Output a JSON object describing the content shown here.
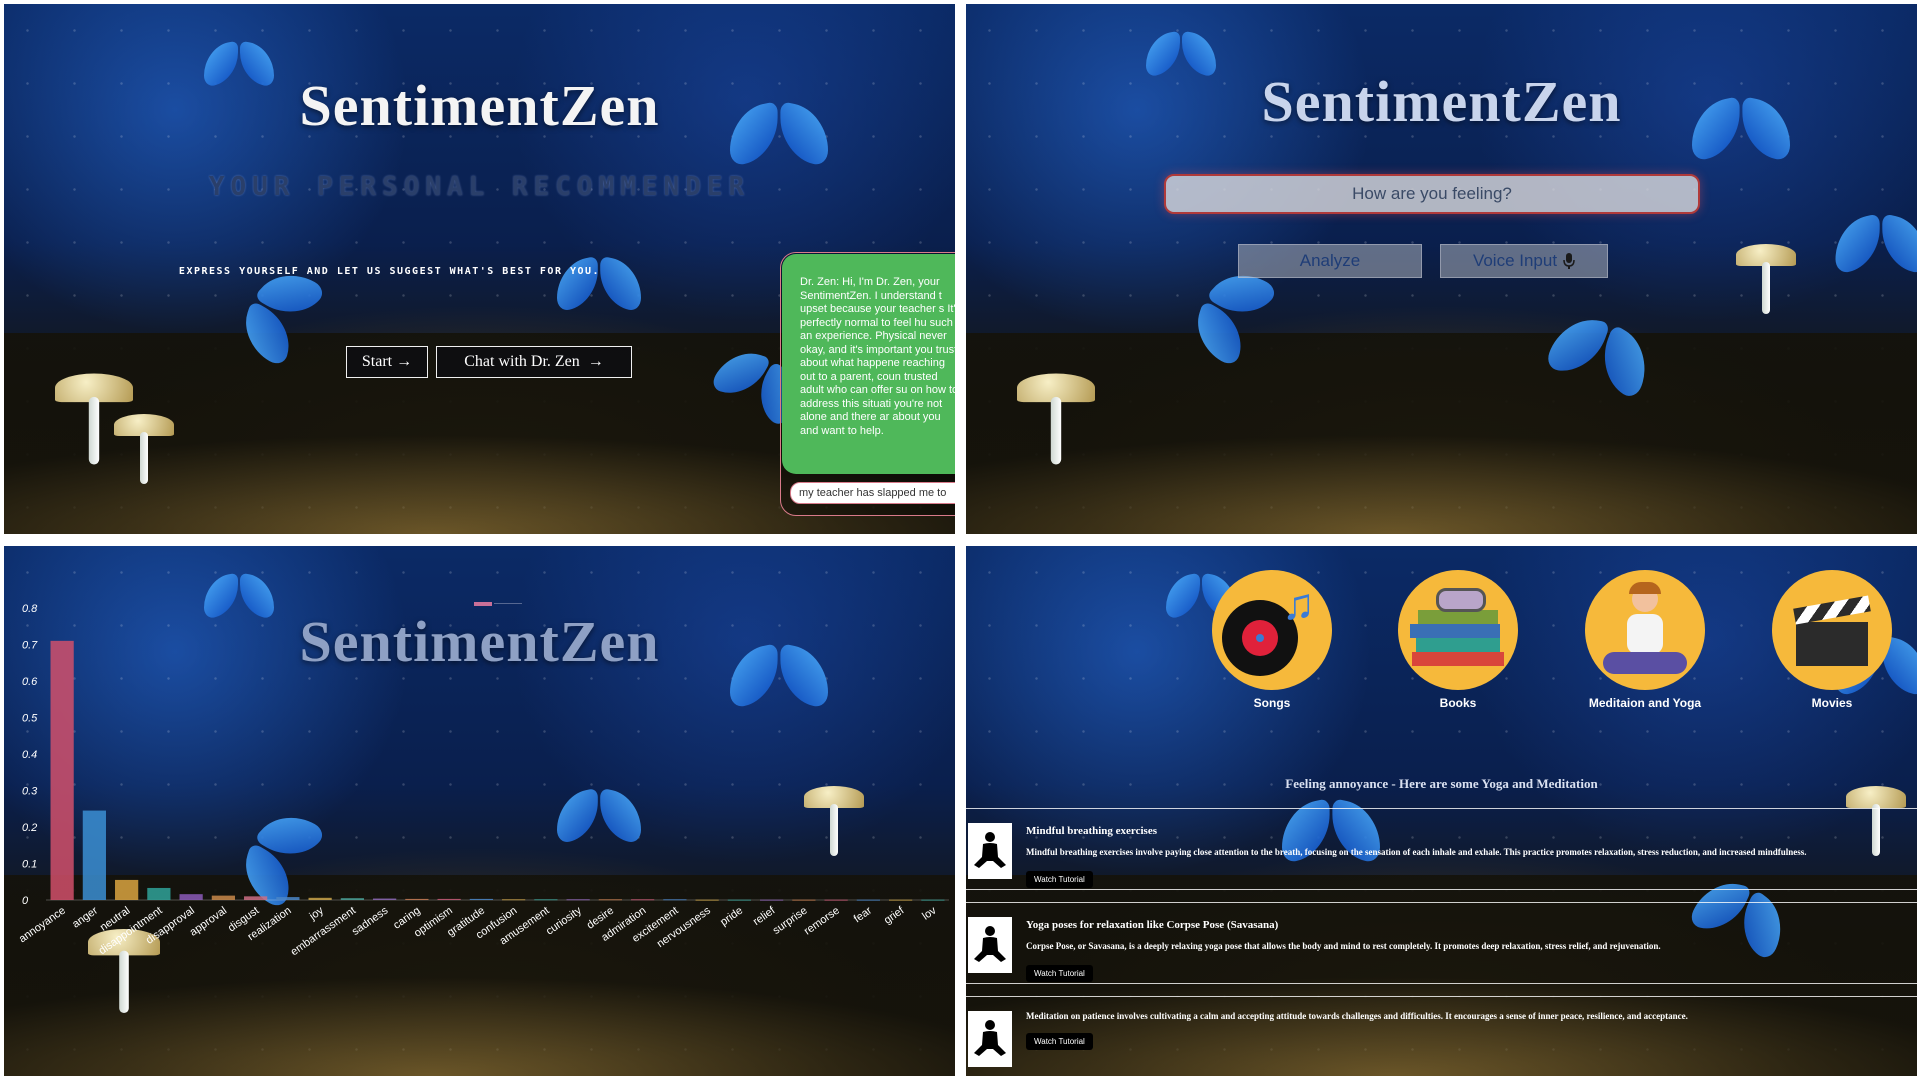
{
  "app": {
    "title": "SentimentZen"
  },
  "home": {
    "subtitle": "YOUR PERSONAL RECOMMENDER",
    "tagline": "EXPRESS YOURSELF AND LET US SUGGEST WHAT'S BEST FOR YOU.",
    "start_label": "Start →",
    "chat_label": "Chat with Dr. Zen",
    "chat_arrow": "→",
    "chat_response": "Dr. Zen: Hi, I'm Dr. Zen, your SentimentZen. I understand t upset because your teacher s It's perfectly normal to feel hu such an experience. Physical never okay, and it's important you trust about what happene reaching out to a parent, coun trusted adult who can offer su on how to address this situati you're not alone and there ar about you and want to help.",
    "chat_input_value": "my teacher has slapped me to"
  },
  "analyze": {
    "placeholder": "How are you feeling?",
    "analyze_label": "Analyze",
    "voice_label": "Voice Input"
  },
  "chart_data": {
    "type": "bar",
    "categories": [
      "annoyance",
      "anger",
      "neutral",
      "disappointment",
      "disapproval",
      "approval",
      "disgust",
      "realization",
      "joy",
      "embarrassment",
      "sadness",
      "caring",
      "optimism",
      "gratitude",
      "confusion",
      "amusement",
      "curiosity",
      "desire",
      "admiration",
      "excitement",
      "nervousness",
      "pride",
      "relief",
      "surprise",
      "remorse",
      "fear",
      "grief",
      "love"
    ],
    "tick_labels": [
      "annoyance",
      "anger",
      "neutral",
      "disappointment",
      "disapproval",
      "approval",
      "disgust",
      "realization",
      "joy",
      "embarrassment",
      "sadness",
      "caring",
      "optimism",
      "gratitude",
      "confusion",
      "amusement",
      "curiosity",
      "desire",
      "admiration",
      "excitement",
      "nervousness",
      "pride",
      "relief",
      "surprise",
      "remorse",
      "fear",
      "grief",
      "lov"
    ],
    "values": [
      0.71,
      0.245,
      0.055,
      0.033,
      0.016,
      0.012,
      0.01,
      0.008,
      0.006,
      0.005,
      0.004,
      0.003,
      0.003,
      0.003,
      0.002,
      0.002,
      0.002,
      0.002,
      0.002,
      0.002,
      0.001,
      0.001,
      0.001,
      0.001,
      0.001,
      0.001,
      0.001,
      0.001
    ],
    "colors": [
      "#d1506b",
      "#3b8fd4",
      "#d9a441",
      "#2fa39a",
      "#8b5bb8",
      "#c98a4a",
      "#cc6f85",
      "#4a86c8",
      "#caa54a",
      "#4aa39a",
      "#8d6ab8",
      "#c67b55",
      "#c75a77",
      "#4a86c8",
      "#c9a04a",
      "#3da39a",
      "#9268bb",
      "#c47c4f",
      "#c75a77",
      "#4a86c8",
      "#caa54a",
      "#3da39a",
      "#9268bb",
      "#c47c4f",
      "#c75a77",
      "#4a86c8",
      "#caa54a",
      "#3da39a"
    ],
    "yticks": [
      "0",
      "0.1",
      "0.2",
      "0.3",
      "0.4",
      "0.5",
      "0.6",
      "0.7",
      "0.8"
    ],
    "ylim": [
      0,
      0.8
    ],
    "legend_swatch_color": "#c96f98"
  },
  "recommend": {
    "categories": [
      {
        "label": "Songs",
        "icon": "music-record-icon"
      },
      {
        "label": "Books",
        "icon": "books-icon"
      },
      {
        "label": "Meditaion and Yoga",
        "icon": "meditation-icon"
      },
      {
        "label": "Movies",
        "icon": "clapperboard-icon"
      }
    ],
    "heading": "Feeling annoyance - Here are some Yoga and Meditation",
    "items": [
      {
        "title": "Mindful breathing exercises",
        "desc": "Mindful breathing exercises involve paying close attention to the breath, focusing on the sensation of each inhale and exhale. This practice promotes relaxation, stress reduction, and increased mindfulness.",
        "button": "Watch Tutorial"
      },
      {
        "title": "Yoga poses for relaxation like Corpse Pose (Savasana)",
        "desc": "Corpse Pose, or Savasana, is a deeply relaxing yoga pose that allows the body and mind to rest completely. It promotes deep relaxation, stress relief, and rejuvenation.",
        "button": "Watch Tutorial"
      },
      {
        "title": "",
        "desc": "Meditation on patience involves cultivating a calm and accepting attitude towards challenges and difficulties. It encourages a sense of inner peace, resilience, and acceptance.",
        "button": "Watch Tutorial"
      }
    ]
  }
}
